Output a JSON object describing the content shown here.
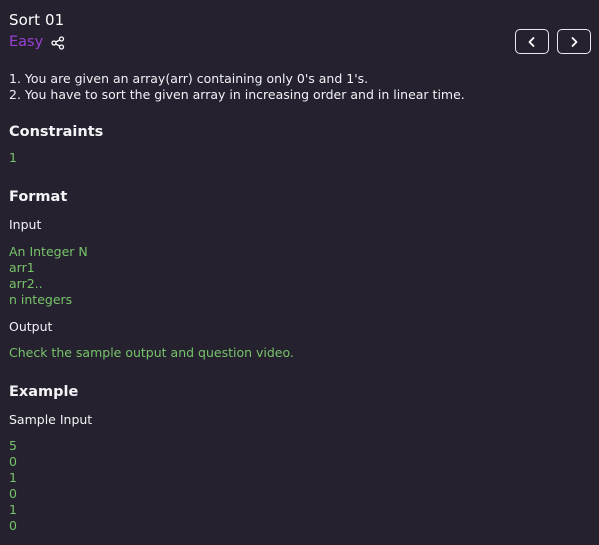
{
  "problem": {
    "title": "Sort 01",
    "difficulty": "Easy",
    "description": [
      "1. You are given an array(arr) containing only 0's and 1's.",
      "2. You have to sort the given array in increasing order and in linear time."
    ]
  },
  "nav": {
    "prev_icon": "chevron-left-icon",
    "next_icon": "chevron-right-icon",
    "share_icon": "share-icon"
  },
  "constraints": {
    "heading": "Constraints",
    "value": "1"
  },
  "format": {
    "heading": "Format",
    "input_label": "Input",
    "input_lines": [
      "An Integer N",
      "arr1",
      "arr2..",
      "n integers"
    ],
    "output_label": "Output",
    "output_text": "Check the sample output and question video."
  },
  "example": {
    "heading": "Example",
    "sample_input_label": "Sample Input",
    "sample_input_lines": [
      "5",
      "0",
      "1",
      "0",
      "1",
      "0"
    ]
  },
  "colors": {
    "background": "#25212f",
    "difficulty": "#9b3fd4",
    "code_green": "#77c46a"
  }
}
